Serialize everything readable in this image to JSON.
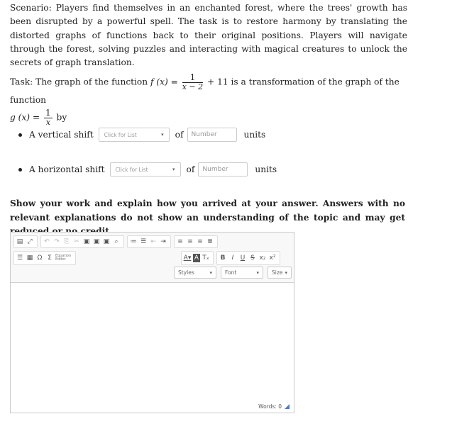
{
  "scenario": "Scenario: Players find themselves in an enchanted forest, where the trees' growth has been disrupted by a powerful spell. The task is to restore harmony by translating the distorted graphs of functions back to their original positions. Players will navigate through the forest, solving puzzles and interacting with magical creatures to unlock the secrets of graph translation.",
  "task": {
    "prefix": "Task: The graph of the function",
    "f_lhs": "f (x) =",
    "f_num": "1",
    "f_den": "x − 2",
    "f_tail": "+ 11",
    "middle": "is a transformation of the graph of the function",
    "g_lhs": "g (x) =",
    "g_num": "1",
    "g_den": "x",
    "suffix": "by"
  },
  "rows": [
    {
      "label": "A vertical shift",
      "select": "Click for List",
      "of": "of",
      "placeholder": "Number",
      "units": "units"
    },
    {
      "label": "A horizontal shift",
      "select": "Click for List",
      "of": "of",
      "placeholder": "Number",
      "units": "units"
    }
  ],
  "instructions": "Show your work and explain how you arrived at your answer. Answers with no relevant explanations do not show an understanding of the topic and may get reduced or no credit.",
  "editor": {
    "equation_editor_label": "Equation Editor",
    "styles": "Styles",
    "font": "Font",
    "size": "Size",
    "words_label": "Words: 0",
    "format_buttons": {
      "bold": "B",
      "italic": "I",
      "underline": "U",
      "strike": "S",
      "subscript": "x₂",
      "superscript": "x²"
    }
  }
}
